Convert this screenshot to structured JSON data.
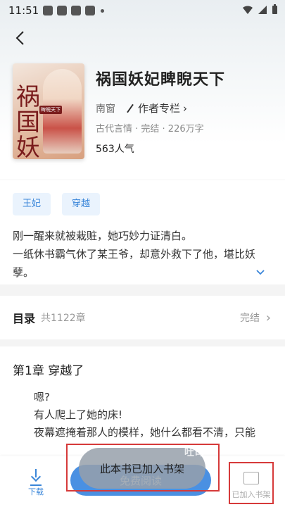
{
  "status": {
    "time": "11:51"
  },
  "book": {
    "title": "祸国妖妃睥睨天下",
    "author": "南窗",
    "author_column": "作者专栏",
    "meta": "古代言情 · 完结 · 226万字",
    "popularity": "563人气",
    "cover_text": "祸国妖妃",
    "cover_badge": "睥睨天下"
  },
  "tags": [
    "王妃",
    "穿越"
  ],
  "description": [
    "刚一醒来就被栽赃，她巧妙力证清白。",
    "一纸休书霸气休了某王爷，却意外救下了他，堪比妖",
    "孽。"
  ],
  "toc": {
    "label": "目录",
    "count": "共1122章",
    "status": "完结"
  },
  "chapter": {
    "title": "第1章  穿越了",
    "lines": [
      "嗯?",
      "有人爬上了她的床!",
      "夜幕遮掩着那人的模样，她什么都看不清，只能"
    ]
  },
  "bottom": {
    "download": "下载",
    "read": "免费阅读",
    "added": "已加入书架"
  },
  "toast": "此本书已加入书架",
  "watermark": "吐司"
}
